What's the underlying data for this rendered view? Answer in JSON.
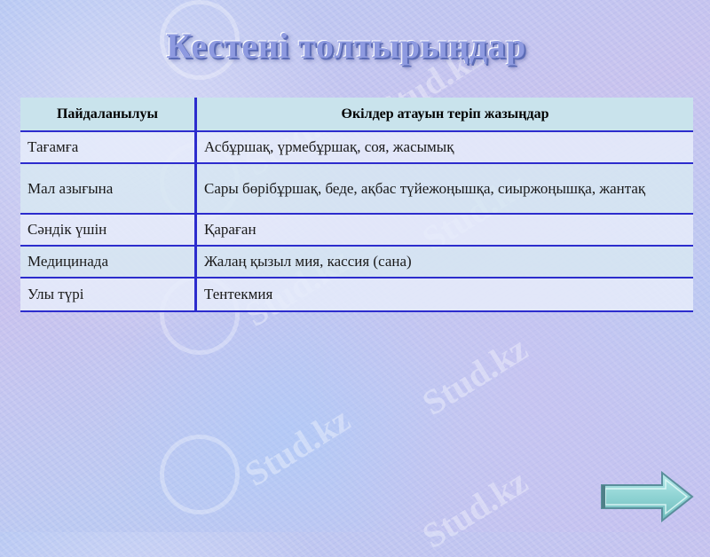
{
  "slide": {
    "title": "Кестені толтырыңдар"
  },
  "watermark_text": "Stud.kz",
  "table": {
    "headers": [
      "Пайдаланылуы",
      "Өкілдер атауын теріп жазыңдар"
    ],
    "rows": [
      {
        "use": "Тағамға",
        "examples": "Асбұршақ, үрмебұршақ, соя, жасымық"
      },
      {
        "use": "Мал азығына",
        "examples": "Сары бөрібұршақ, беде, ақбас түйежоңышқа, сиыржоңышқа, жантақ"
      },
      {
        "use": "Сәндік үшін",
        "examples": "Қараған"
      },
      {
        "use": "Медицинада",
        "examples": "Жалаң қызыл мия, кассия (сана)"
      },
      {
        "use": "Улы түрі",
        "examples": "Тентекмия"
      }
    ]
  },
  "colors": {
    "title": "#8e9ae0",
    "header_bg": "#c9e3ec",
    "grid_line": "#2c2ccd",
    "next_button": "#8fd3d3"
  },
  "icons": {
    "next": "arrow-right-icon"
  }
}
